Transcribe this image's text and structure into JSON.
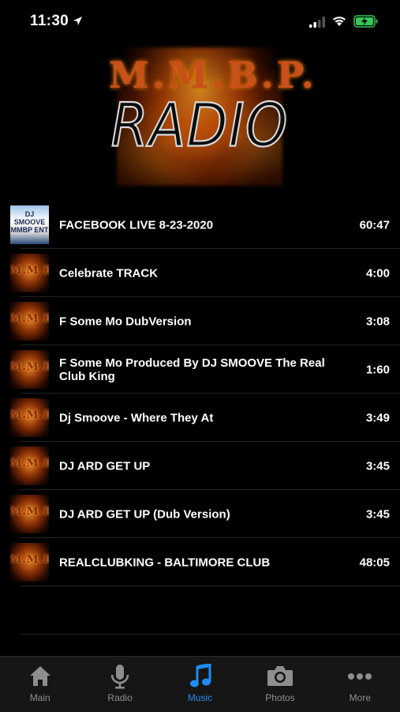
{
  "status_bar": {
    "time": "11:30"
  },
  "header": {
    "logo_top_text": "M.M.B.P.",
    "logo_bottom_text": "RADIO"
  },
  "tracks": [
    {
      "title": "FACEBOOK LIVE 8-23-2020",
      "duration": "60:47",
      "thumb": "photo",
      "thumb_text": "DJ SMOOVE MMBP ENT"
    },
    {
      "title": "Celebrate TRACK",
      "duration": "4:00",
      "thumb": "fire",
      "thumb_text": "M.M.B.P."
    },
    {
      "title": "F Some Mo DubVersion",
      "duration": "3:08",
      "thumb": "fire",
      "thumb_text": "M.M.B.P."
    },
    {
      "title": "F Some Mo Produced By DJ SMOOVE The Real Club King",
      "duration": "1:60",
      "thumb": "fire",
      "thumb_text": "M.M.B.P."
    },
    {
      "title": "Dj Smoove - Where They At",
      "duration": "3:49",
      "thumb": "fire",
      "thumb_text": "M.M.B.P."
    },
    {
      "title": "DJ ARD GET UP",
      "duration": "3:45",
      "thumb": "fire",
      "thumb_text": "M.M.B.P."
    },
    {
      "title": "DJ ARD GET UP (Dub Version)",
      "duration": "3:45",
      "thumb": "fire",
      "thumb_text": "M.M.B.P."
    },
    {
      "title": "REALCLUBKING - BALTIMORE CLUB",
      "duration": "48:05",
      "thumb": "fire",
      "thumb_text": "M.M.B.P."
    }
  ],
  "tab_bar": {
    "tabs": [
      {
        "label": "Main",
        "icon": "home-icon",
        "active": false
      },
      {
        "label": "Radio",
        "icon": "microphone-icon",
        "active": false
      },
      {
        "label": "Music",
        "icon": "music-note-icon",
        "active": true
      },
      {
        "label": "Photos",
        "icon": "camera-icon",
        "active": false
      },
      {
        "label": "More",
        "icon": "more-dots-icon",
        "active": false
      }
    ]
  },
  "colors": {
    "background": "#000000",
    "accent": "#1f8df5",
    "tab_inactive": "#8e8e8e",
    "battery_fill": "#34c759"
  }
}
